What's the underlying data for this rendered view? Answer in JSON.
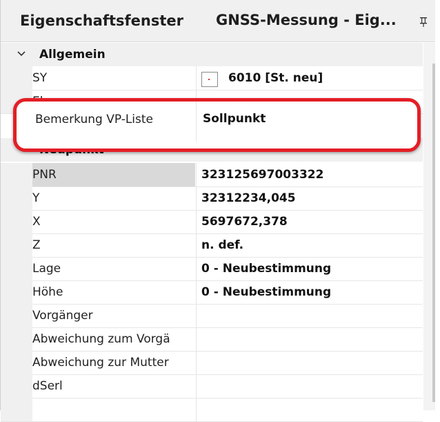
{
  "header": {
    "title": "Eigenschaftsfenster",
    "subtitle": "GNSS-Messung - Eig...",
    "pin_icon": "pin-icon"
  },
  "categories": {
    "allgemein": "Allgemein",
    "neupunkt": "Neupunkt"
  },
  "rows": {
    "sy": {
      "name": "SY",
      "value": "6010 [St. neu]"
    },
    "ebene": {
      "name": "Ebene",
      "value": ""
    },
    "pnr": {
      "name": "PNR",
      "value": "323125697003322"
    },
    "y": {
      "name": "Y",
      "value": "32312234,045"
    },
    "x": {
      "name": "X",
      "value": "5697672,378"
    },
    "z": {
      "name": "Z",
      "value": "n. def."
    },
    "lage": {
      "name": "Lage",
      "value": "0 - Neubestimmung"
    },
    "hoehe": {
      "name": "Höhe",
      "value": "0 - Neubestimmung"
    },
    "vorgaenger": {
      "name": "Vorgänger",
      "value": ""
    },
    "abw_vorg": {
      "name": "Abweichung zum Vorgä",
      "value": ""
    },
    "abw_mutter": {
      "name": "Abweichung zur Mutter",
      "value": ""
    },
    "dserl": {
      "name": "dSerl",
      "value": ""
    }
  },
  "highlight": {
    "name": "Bemerkung VP-Liste",
    "value": "Sollpunkt"
  },
  "colors": {
    "highlight_border": "#e41e26",
    "header_bg": "#f0f0f0"
  }
}
